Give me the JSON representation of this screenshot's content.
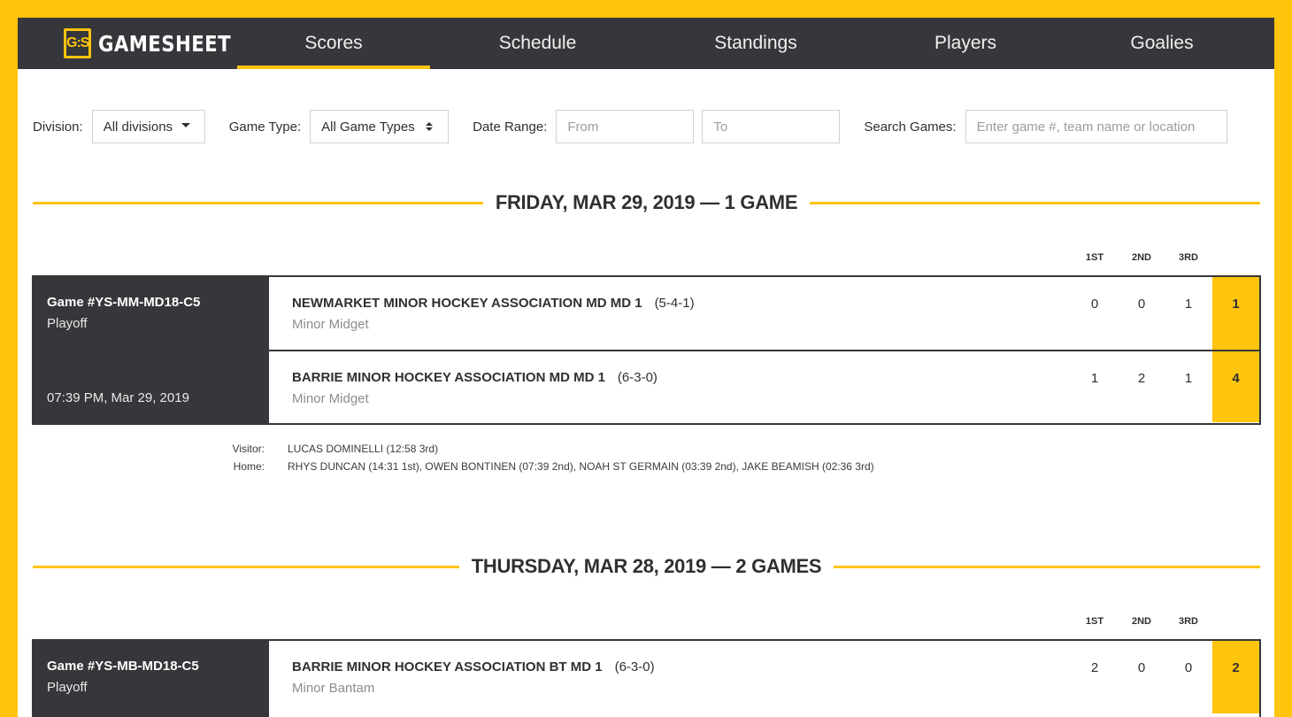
{
  "brand": {
    "logo_text": "G:S",
    "name": "GAMESHEET",
    "accent": "#FFC40C",
    "dark": "#36373A"
  },
  "nav": {
    "tabs": [
      {
        "label": "Scores",
        "active": true
      },
      {
        "label": "Schedule",
        "active": false
      },
      {
        "label": "Standings",
        "active": false
      },
      {
        "label": "Players",
        "active": false
      },
      {
        "label": "Goalies",
        "active": false
      }
    ]
  },
  "filters": {
    "division_label": "Division:",
    "division_value": "All divisions",
    "game_type_label": "Game Type:",
    "game_type_value": "All Game Types",
    "date_range_label": "Date Range:",
    "from_placeholder": "From",
    "to_placeholder": "To",
    "search_label": "Search Games:",
    "search_placeholder": "Enter game #, team name or location"
  },
  "days": [
    {
      "heading": "FRIDAY, MAR 29, 2019 — 1 GAME",
      "period_headers": [
        "1ST",
        "2ND",
        "3RD"
      ],
      "games": [
        {
          "id": "Game #YS-MM-MD18-C5",
          "type": "Playoff",
          "datetime": "07:39 PM, Mar 29, 2019",
          "teams": [
            {
              "name": "NEWMARKET MINOR HOCKEY ASSOCIATION MD MD 1",
              "record": "(5-4-1)",
              "division": "Minor Midget",
              "periods": [
                "0",
                "0",
                "1"
              ],
              "total": "1"
            },
            {
              "name": "BARRIE MINOR HOCKEY ASSOCIATION MD MD 1",
              "record": "(6-3-0)",
              "division": "Minor Midget",
              "periods": [
                "1",
                "2",
                "1"
              ],
              "total": "4"
            }
          ],
          "goals": {
            "visitor_label": "Visitor:",
            "visitor": "LUCAS DOMINELLI (12:58 3rd)",
            "home_label": "Home:",
            "home": "RHYS DUNCAN (14:31 1st), OWEN BONTINEN (07:39 2nd), NOAH ST GERMAIN (03:39 2nd), JAKE BEAMISH (02:36 3rd)"
          }
        }
      ]
    },
    {
      "heading": "THURSDAY, MAR 28, 2019 — 2 GAMES",
      "period_headers": [
        "1ST",
        "2ND",
        "3RD"
      ],
      "games": [
        {
          "id": "Game #YS-MB-MD18-C5",
          "type": "Playoff",
          "teams": [
            {
              "name": "BARRIE MINOR HOCKEY ASSOCIATION BT MD 1",
              "record": "(6-3-0)",
              "division": "Minor Bantam",
              "periods": [
                "2",
                "0",
                "0"
              ],
              "total": "2"
            }
          ]
        }
      ]
    }
  ]
}
